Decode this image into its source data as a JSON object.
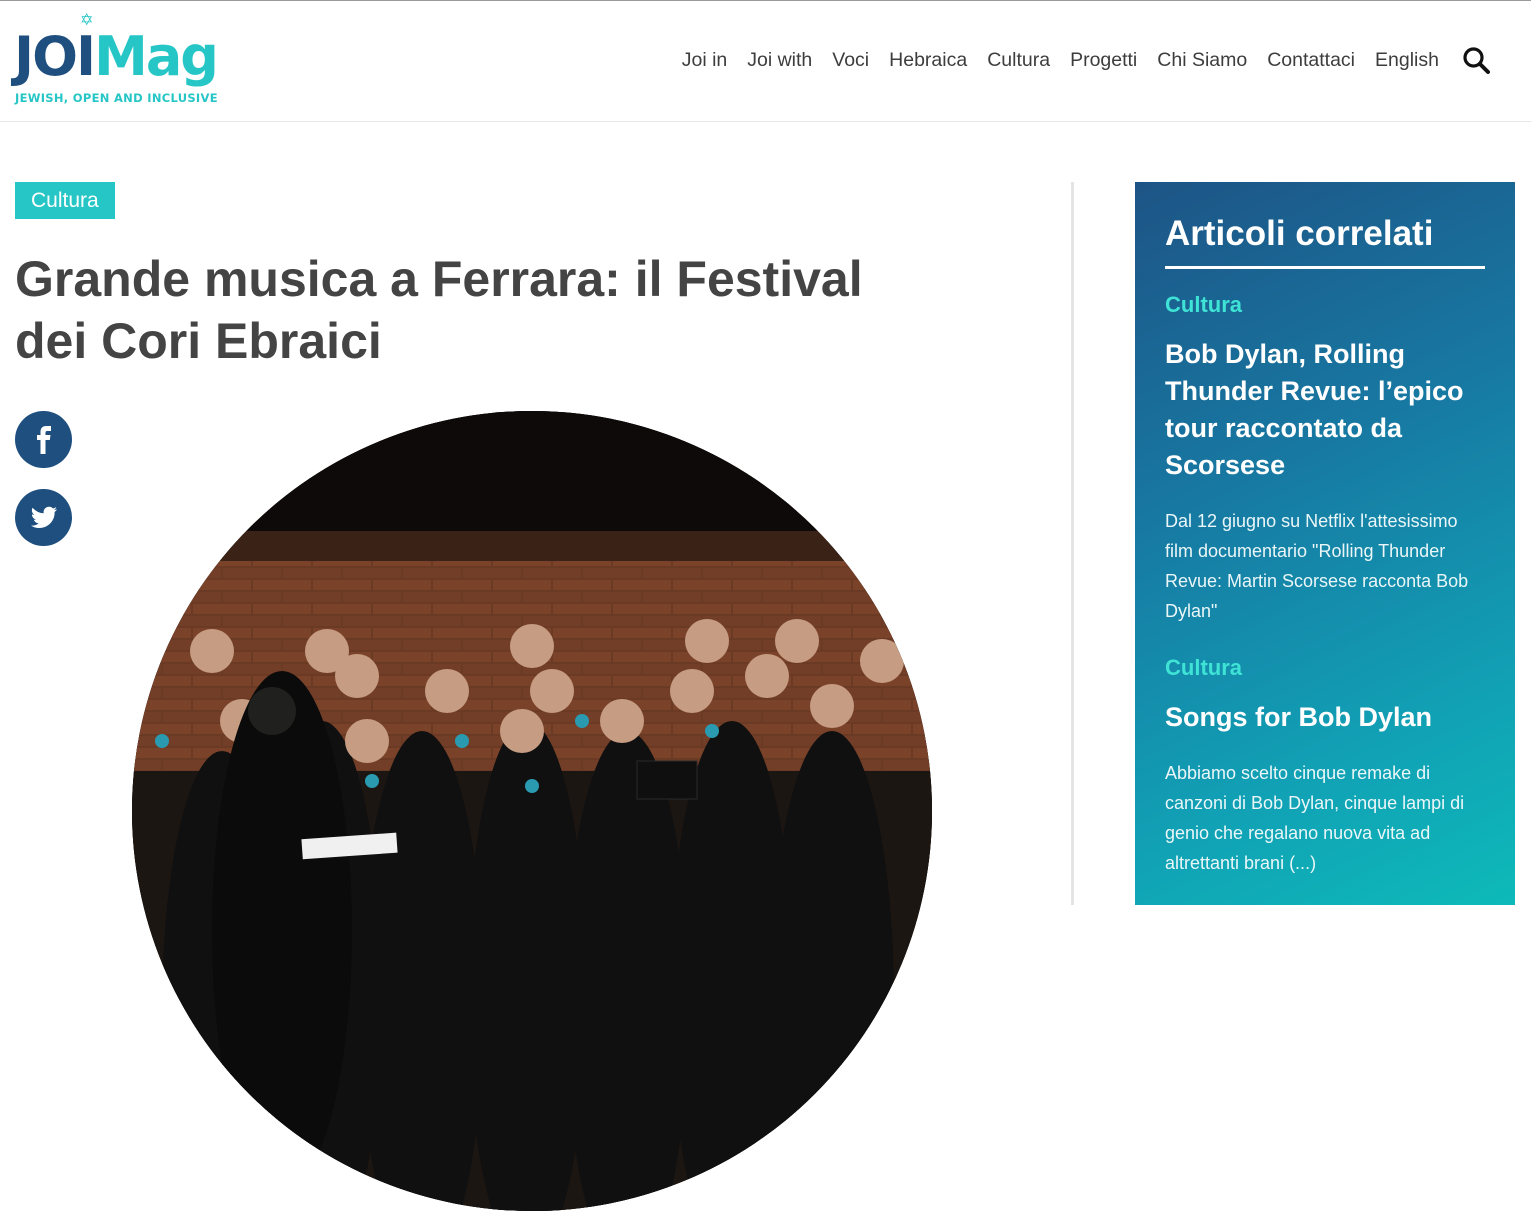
{
  "brand": {
    "logo_joi": "JOI",
    "logo_mag": "Mag",
    "tagline": "JEWISH, OPEN AND INCLUSIVE",
    "colors": {
      "navy": "#1e4f7f",
      "teal": "#26c6c6"
    }
  },
  "nav": {
    "items": [
      "Joi in",
      "Joi with",
      "Voci",
      "Hebraica",
      "Cultura",
      "Progetti",
      "Chi Siamo",
      "Contattaci",
      "English"
    ],
    "search_icon": "search-icon"
  },
  "article": {
    "category": "Cultura",
    "title": "Grande musica a Ferrara: il Festival dei Cori Ebraici",
    "share": [
      "facebook-icon",
      "twitter-icon"
    ]
  },
  "sidebar": {
    "heading": "Articoli correlati",
    "items": [
      {
        "category": "Cultura",
        "title": "Bob Dylan, Rolling Thunder Revue: l’epico tour raccontato da Scorsese",
        "excerpt": "Dal 12 giugno su Netflix l'attesissimo film documentario \"Rolling Thunder Revue: Martin Scorsese racconta Bob Dylan\""
      },
      {
        "category": "Cultura",
        "title": "Songs for Bob Dylan",
        "excerpt": "Abbiamo scelto cinque remake di canzoni di Bob Dylan, cinque lampi di genio che regalano nuova vita ad altrettanti brani (...)"
      }
    ]
  }
}
